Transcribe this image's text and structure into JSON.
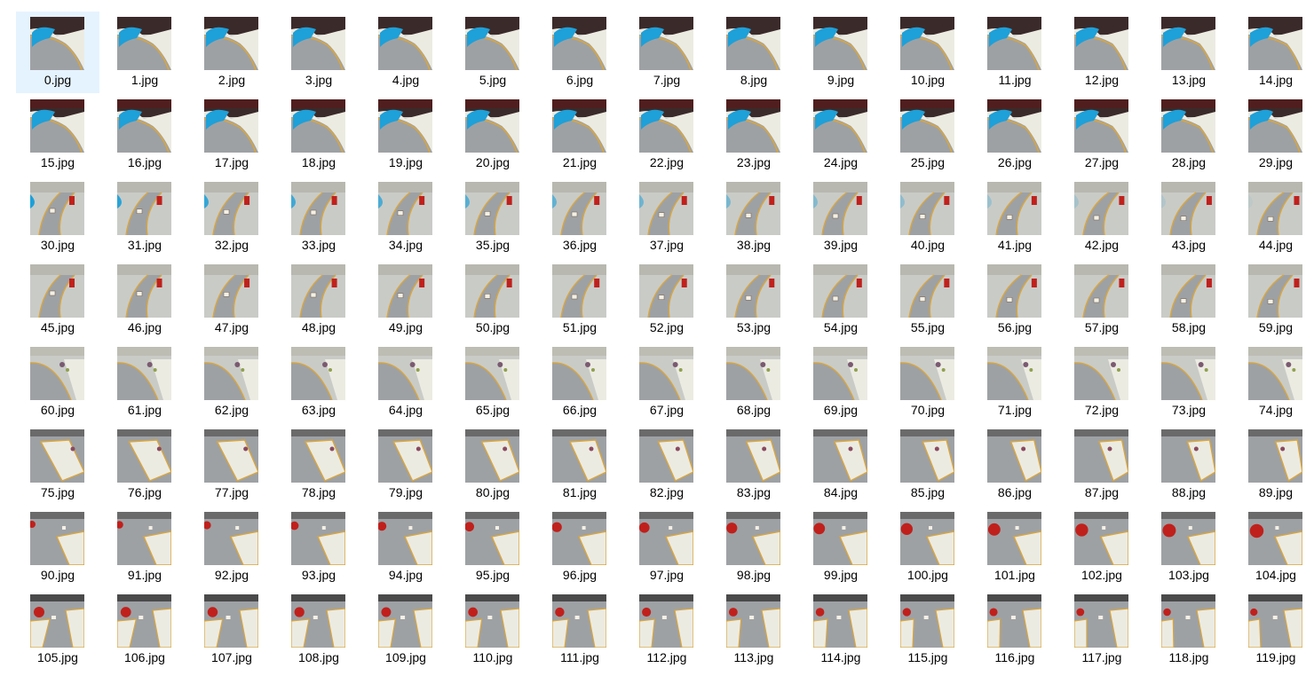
{
  "folder": {
    "selected_index": 0,
    "file_extension": ".jpg",
    "files": [
      {
        "name": "0.jpg",
        "scene": "blue-mat"
      },
      {
        "name": "1.jpg",
        "scene": "blue-mat"
      },
      {
        "name": "2.jpg",
        "scene": "blue-mat"
      },
      {
        "name": "3.jpg",
        "scene": "blue-mat"
      },
      {
        "name": "4.jpg",
        "scene": "blue-mat"
      },
      {
        "name": "5.jpg",
        "scene": "blue-mat"
      },
      {
        "name": "6.jpg",
        "scene": "blue-mat"
      },
      {
        "name": "7.jpg",
        "scene": "blue-mat"
      },
      {
        "name": "8.jpg",
        "scene": "blue-mat"
      },
      {
        "name": "9.jpg",
        "scene": "blue-mat"
      },
      {
        "name": "10.jpg",
        "scene": "blue-mat"
      },
      {
        "name": "11.jpg",
        "scene": "blue-mat"
      },
      {
        "name": "12.jpg",
        "scene": "blue-mat"
      },
      {
        "name": "13.jpg",
        "scene": "blue-mat"
      },
      {
        "name": "14.jpg",
        "scene": "blue-mat"
      },
      {
        "name": "15.jpg",
        "scene": "blue-pond"
      },
      {
        "name": "16.jpg",
        "scene": "blue-pond"
      },
      {
        "name": "17.jpg",
        "scene": "blue-pond"
      },
      {
        "name": "18.jpg",
        "scene": "blue-pond"
      },
      {
        "name": "19.jpg",
        "scene": "blue-pond"
      },
      {
        "name": "20.jpg",
        "scene": "blue-pond"
      },
      {
        "name": "21.jpg",
        "scene": "blue-pond"
      },
      {
        "name": "22.jpg",
        "scene": "blue-pond"
      },
      {
        "name": "23.jpg",
        "scene": "blue-pond"
      },
      {
        "name": "24.jpg",
        "scene": "blue-pond"
      },
      {
        "name": "25.jpg",
        "scene": "blue-pond"
      },
      {
        "name": "26.jpg",
        "scene": "blue-pond"
      },
      {
        "name": "27.jpg",
        "scene": "blue-pond"
      },
      {
        "name": "28.jpg",
        "scene": "blue-pond"
      },
      {
        "name": "29.jpg",
        "scene": "blue-pond"
      },
      {
        "name": "30.jpg",
        "scene": "curve-sign"
      },
      {
        "name": "31.jpg",
        "scene": "curve-sign"
      },
      {
        "name": "32.jpg",
        "scene": "curve-sign"
      },
      {
        "name": "33.jpg",
        "scene": "curve-sign"
      },
      {
        "name": "34.jpg",
        "scene": "curve-sign"
      },
      {
        "name": "35.jpg",
        "scene": "curve-sign"
      },
      {
        "name": "36.jpg",
        "scene": "curve-sign"
      },
      {
        "name": "37.jpg",
        "scene": "curve-sign"
      },
      {
        "name": "38.jpg",
        "scene": "curve-sign"
      },
      {
        "name": "39.jpg",
        "scene": "curve-sign"
      },
      {
        "name": "40.jpg",
        "scene": "curve-sign"
      },
      {
        "name": "41.jpg",
        "scene": "curve-sign"
      },
      {
        "name": "42.jpg",
        "scene": "curve-sign"
      },
      {
        "name": "43.jpg",
        "scene": "curve-sign"
      },
      {
        "name": "44.jpg",
        "scene": "curve-sign"
      },
      {
        "name": "45.jpg",
        "scene": "road-sign"
      },
      {
        "name": "46.jpg",
        "scene": "road-sign"
      },
      {
        "name": "47.jpg",
        "scene": "road-sign"
      },
      {
        "name": "48.jpg",
        "scene": "road-sign"
      },
      {
        "name": "49.jpg",
        "scene": "road-sign"
      },
      {
        "name": "50.jpg",
        "scene": "road-sign"
      },
      {
        "name": "51.jpg",
        "scene": "road-sign"
      },
      {
        "name": "52.jpg",
        "scene": "road-sign"
      },
      {
        "name": "53.jpg",
        "scene": "road-sign"
      },
      {
        "name": "54.jpg",
        "scene": "road-sign"
      },
      {
        "name": "55.jpg",
        "scene": "road-sign"
      },
      {
        "name": "56.jpg",
        "scene": "road-sign"
      },
      {
        "name": "57.jpg",
        "scene": "road-sign"
      },
      {
        "name": "58.jpg",
        "scene": "road-sign"
      },
      {
        "name": "59.jpg",
        "scene": "road-sign"
      },
      {
        "name": "60.jpg",
        "scene": "plants"
      },
      {
        "name": "61.jpg",
        "scene": "plants"
      },
      {
        "name": "62.jpg",
        "scene": "plants"
      },
      {
        "name": "63.jpg",
        "scene": "plants"
      },
      {
        "name": "64.jpg",
        "scene": "plants"
      },
      {
        "name": "65.jpg",
        "scene": "plants"
      },
      {
        "name": "66.jpg",
        "scene": "plants"
      },
      {
        "name": "67.jpg",
        "scene": "plants"
      },
      {
        "name": "68.jpg",
        "scene": "plants"
      },
      {
        "name": "69.jpg",
        "scene": "plants"
      },
      {
        "name": "70.jpg",
        "scene": "plants"
      },
      {
        "name": "71.jpg",
        "scene": "plants"
      },
      {
        "name": "72.jpg",
        "scene": "plants"
      },
      {
        "name": "73.jpg",
        "scene": "plants"
      },
      {
        "name": "74.jpg",
        "scene": "plants"
      },
      {
        "name": "75.jpg",
        "scene": "white-panel"
      },
      {
        "name": "76.jpg",
        "scene": "white-panel"
      },
      {
        "name": "77.jpg",
        "scene": "white-panel"
      },
      {
        "name": "78.jpg",
        "scene": "white-panel"
      },
      {
        "name": "79.jpg",
        "scene": "white-panel"
      },
      {
        "name": "80.jpg",
        "scene": "white-panel"
      },
      {
        "name": "81.jpg",
        "scene": "white-panel"
      },
      {
        "name": "82.jpg",
        "scene": "white-panel"
      },
      {
        "name": "83.jpg",
        "scene": "white-panel"
      },
      {
        "name": "84.jpg",
        "scene": "white-panel"
      },
      {
        "name": "85.jpg",
        "scene": "white-panel"
      },
      {
        "name": "86.jpg",
        "scene": "white-panel"
      },
      {
        "name": "87.jpg",
        "scene": "white-panel"
      },
      {
        "name": "88.jpg",
        "scene": "white-panel"
      },
      {
        "name": "89.jpg",
        "scene": "white-panel"
      },
      {
        "name": "90.jpg",
        "scene": "red-object"
      },
      {
        "name": "91.jpg",
        "scene": "red-object"
      },
      {
        "name": "92.jpg",
        "scene": "red-object"
      },
      {
        "name": "93.jpg",
        "scene": "red-object"
      },
      {
        "name": "94.jpg",
        "scene": "red-object"
      },
      {
        "name": "95.jpg",
        "scene": "red-object"
      },
      {
        "name": "96.jpg",
        "scene": "red-object"
      },
      {
        "name": "97.jpg",
        "scene": "red-object"
      },
      {
        "name": "98.jpg",
        "scene": "red-object"
      },
      {
        "name": "99.jpg",
        "scene": "red-object"
      },
      {
        "name": "100.jpg",
        "scene": "red-object"
      },
      {
        "name": "101.jpg",
        "scene": "red-object"
      },
      {
        "name": "102.jpg",
        "scene": "red-object"
      },
      {
        "name": "103.jpg",
        "scene": "red-object"
      },
      {
        "name": "104.jpg",
        "scene": "red-object"
      },
      {
        "name": "105.jpg",
        "scene": "red-cone"
      },
      {
        "name": "106.jpg",
        "scene": "red-cone"
      },
      {
        "name": "107.jpg",
        "scene": "red-cone"
      },
      {
        "name": "108.jpg",
        "scene": "red-cone"
      },
      {
        "name": "109.jpg",
        "scene": "red-cone"
      },
      {
        "name": "110.jpg",
        "scene": "red-cone"
      },
      {
        "name": "111.jpg",
        "scene": "red-cone"
      },
      {
        "name": "112.jpg",
        "scene": "red-cone"
      },
      {
        "name": "113.jpg",
        "scene": "red-cone"
      },
      {
        "name": "114.jpg",
        "scene": "red-cone"
      },
      {
        "name": "115.jpg",
        "scene": "red-cone"
      },
      {
        "name": "116.jpg",
        "scene": "red-cone"
      },
      {
        "name": "117.jpg",
        "scene": "red-cone"
      },
      {
        "name": "118.jpg",
        "scene": "red-cone"
      },
      {
        "name": "119.jpg",
        "scene": "red-cone"
      }
    ]
  },
  "colors": {
    "selection_background": "#e5f3ff",
    "label_text": "#000000",
    "road_gray": "#9ea1a4",
    "lane_line_yellow": "#d8a640",
    "mat_blue": "#1ea0d8",
    "object_red": "#c0201c",
    "mat_white": "#ecebe2"
  }
}
